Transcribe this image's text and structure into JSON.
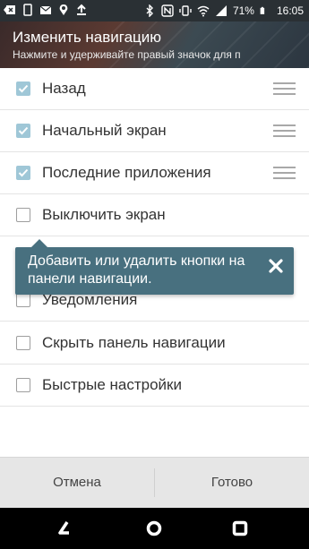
{
  "status_bar": {
    "battery": "71%",
    "time": "16:05",
    "icons": [
      "back-arrow-icon",
      "phone-icon",
      "mail-icon",
      "location-icon",
      "upload-icon",
      "bluetooth-icon",
      "nfc-icon",
      "vibrate-icon",
      "wifi-icon",
      "signal-icon",
      "battery-icon"
    ]
  },
  "header": {
    "title": "Изменить навигацию",
    "subtitle": "Нажмите и удерживайте правый значок для п"
  },
  "items": [
    {
      "label": "Назад",
      "checked": true,
      "draggable": true
    },
    {
      "label": "Начальный экран",
      "checked": true,
      "draggable": true
    },
    {
      "label": "Последние приложения",
      "checked": true,
      "draggable": true
    },
    {
      "label": "Выключить экран",
      "checked": false,
      "draggable": false
    },
    {
      "label": "Уведомления",
      "checked": false,
      "draggable": false
    },
    {
      "label": "Скрыть панель навигации",
      "checked": false,
      "draggable": false
    },
    {
      "label": "Быстрые настройки",
      "checked": false,
      "draggable": false
    }
  ],
  "tooltip": {
    "text": "Добавить или удалить кнопки на панели навигации."
  },
  "actions": {
    "cancel": "Отмена",
    "done": "Готово"
  },
  "colors": {
    "header_bg": "#4b3a34",
    "tooltip_bg": "#48707f",
    "checked": "#9fc7d7",
    "action_bar": "#e6e6e6",
    "nav_bar": "#000000"
  }
}
